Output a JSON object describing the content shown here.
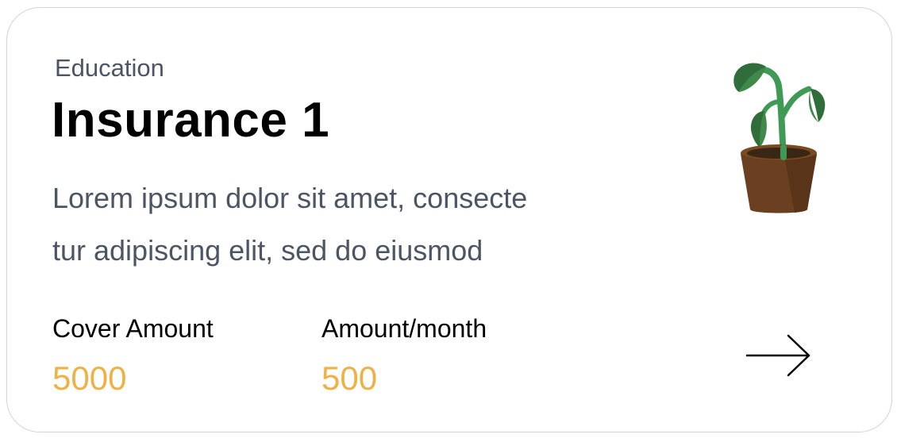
{
  "card": {
    "category": "Education",
    "title": "Insurance 1",
    "description_line1": "Lorem ipsum dolor sit amet, consecte",
    "description_line2": "tur adipiscing elit, sed do eiusmod",
    "cover_amount": {
      "label": "Cover Amount",
      "value": "5000"
    },
    "amount_month": {
      "label": "Amount/month",
      "value": "500"
    },
    "icons": {
      "illustration": "potted-plant-icon",
      "action": "arrow-right-icon"
    },
    "colors": {
      "accent": "#eeb145",
      "muted_text": "#4b5563",
      "border": "#d4d4d4"
    }
  }
}
